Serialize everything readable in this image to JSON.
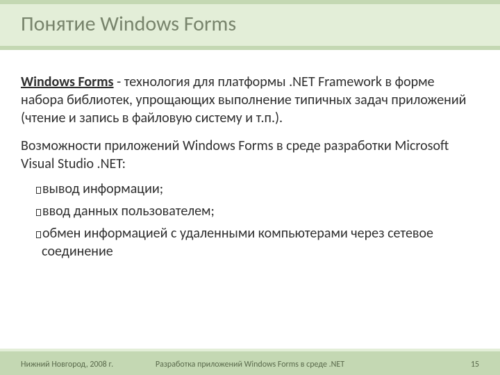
{
  "slide": {
    "title": "Понятие Windows Forms",
    "term": "Windows Forms",
    "para1_rest": "  - технология для платформы .NET Framework в форме набора библиотек, упрощающих выполнение типичных задач приложений (чтение и запись в файловую систему и т.п.).",
    "para2": "Возможности приложений Windows Forms в среде разработки Microsoft Visual Studio .NET:",
    "bullets": [
      "вывод информации;",
      "ввод данных пользователем;",
      "обмен информацией с удаленными компьютерами через сетевое соединение"
    ]
  },
  "footer": {
    "left": "Нижний Новгород, 2008 г.",
    "center": "Разработка приложений Windows Forms в среде .NET",
    "page": "15"
  }
}
